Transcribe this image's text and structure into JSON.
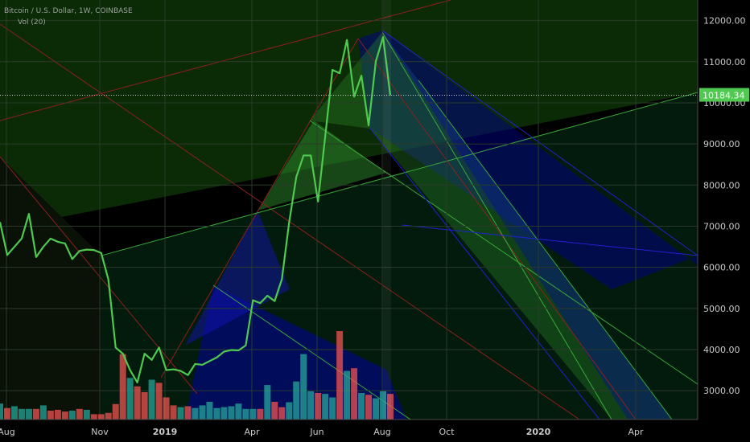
{
  "header": {
    "symbol_line": "Bitcoin / U.S. Dollar, 1W, COINBASE",
    "indicator_line": "Vol (20)"
  },
  "chart_data": {
    "type": "line",
    "symbol": "Bitcoin / U.S. Dollar",
    "interval": "1W",
    "exchange": "COINBASE",
    "x_labels": [
      "Aug",
      "Nov",
      "2019",
      "Apr",
      "Jun",
      "Aug",
      "Oct",
      "2020",
      "Apr"
    ],
    "y_ticks": [
      3000,
      4000,
      5000,
      6000,
      7000,
      8000,
      9000,
      10000,
      11000,
      12000
    ],
    "y_tick_labels": [
      "3000.00",
      "4000.00",
      "5000.00",
      "6000.00",
      "7000.00",
      "8000.00",
      "9000.00",
      "10000.00",
      "11000.00",
      "12000.00"
    ],
    "ylim": [
      2300,
      12500
    ],
    "current_price": 10184.34,
    "current_price_label": "10184.34",
    "price_series": {
      "name": "BTCUSD close",
      "color": "#4fc94f",
      "values": [
        7100,
        6300,
        6500,
        6700,
        7300,
        6250,
        6500,
        6700,
        6620,
        6580,
        6200,
        6400,
        6430,
        6420,
        6350,
        5700,
        4050,
        3900,
        3500,
        3200,
        3900,
        3750,
        4050,
        3500,
        3520,
        3480,
        3380,
        3650,
        3630,
        3720,
        3810,
        3950,
        3990,
        3980,
        4100,
        5200,
        5130,
        5310,
        5180,
        5710,
        7090,
        8200,
        8720,
        8720,
        7600,
        9190,
        10800,
        10720,
        11530,
        10150,
        10660,
        9450,
        11010,
        11600,
        10184
      ]
    },
    "volume_series": {
      "name": "Vol (20)",
      "up_color": "#26a69a",
      "down_color": "#ef5350",
      "values": [
        0.36,
        0.26,
        0.3,
        0.24,
        0.24,
        0.24,
        0.32,
        0.2,
        0.22,
        0.18,
        0.2,
        0.24,
        0.22,
        0.12,
        0.12,
        0.15,
        0.35,
        1.48,
        0.94,
        0.75,
        0.62,
        0.9,
        0.83,
        0.5,
        0.32,
        0.28,
        0.3,
        0.26,
        0.32,
        0.4,
        0.26,
        0.28,
        0.3,
        0.36,
        0.24,
        0.24,
        0.24,
        0.78,
        0.4,
        0.28,
        0.39,
        0.86,
        1.48,
        0.64,
        0.6,
        0.58,
        0.5,
        2.0,
        1.1,
        1.16,
        0.6,
        0.56,
        0.48,
        0.64,
        0.58
      ],
      "up": [
        true,
        false,
        true,
        true,
        true,
        false,
        true,
        false,
        false,
        false,
        true,
        false,
        true,
        false,
        false,
        false,
        false,
        false,
        true,
        false,
        false,
        true,
        false,
        false,
        false,
        true,
        false,
        true,
        true,
        true,
        true,
        true,
        true,
        true,
        true,
        true,
        false,
        true,
        false,
        false,
        true,
        true,
        true,
        true,
        false,
        true,
        true,
        false,
        true,
        false,
        true,
        false,
        true,
        true,
        false
      ]
    },
    "colors": {
      "background": "#000000",
      "upper_zone": "#0b2a06",
      "lower_zone": "#001a10",
      "blue_fan": "#00009a",
      "green_fan": "#2e8b2e",
      "red_line": "#8b2020",
      "green_line": "#3aa83a",
      "price_tag": "#4fc94f"
    },
    "grid": true,
    "legend": "none"
  }
}
